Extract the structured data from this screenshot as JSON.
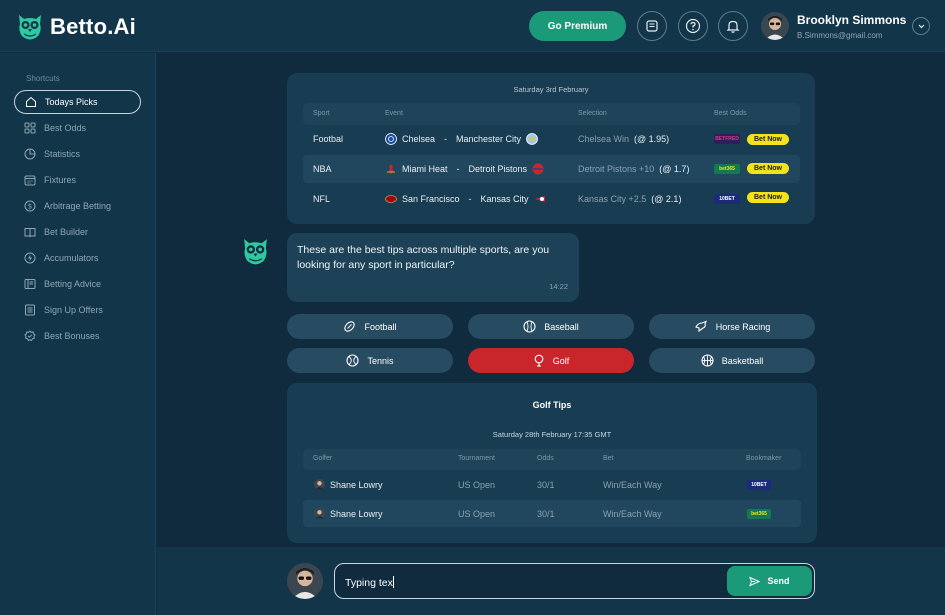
{
  "app": {
    "name": "Betto.Ai"
  },
  "header": {
    "premium_label": "Go Premium",
    "user": {
      "name": "Brooklyn Simmons",
      "email": "B.Simmons@gmail.com"
    }
  },
  "sidebar": {
    "title": "Shortcuts",
    "items": [
      {
        "label": "Todays Picks",
        "icon": "home-icon",
        "active": true
      },
      {
        "label": "Best Odds",
        "icon": "grid-icon"
      },
      {
        "label": "Statistics",
        "icon": "pie-chart-icon"
      },
      {
        "label": "Fixtures",
        "icon": "calendar-icon"
      },
      {
        "label": "Arbitrage Betting",
        "icon": "dollar-icon"
      },
      {
        "label": "Bet Builder",
        "icon": "book-icon"
      },
      {
        "label": "Accumulators",
        "icon": "lightning-icon"
      },
      {
        "label": "Betting Advice",
        "icon": "book-open-icon"
      },
      {
        "label": "Sign Up Offers",
        "icon": "list-icon"
      },
      {
        "label": "Best Bonuses",
        "icon": "badge-icon"
      }
    ]
  },
  "picks": {
    "date": "Saturday 3rd February",
    "headers": [
      "Sport",
      "Event",
      "Selection",
      "Best Odds"
    ],
    "rows": [
      {
        "sport": "Footbal",
        "home": "Chelsea",
        "sep": "-",
        "away": "Manchester City",
        "selection": "Chelsea Win",
        "odds": "(@ 1.95)",
        "bookmaker": "BETFRED",
        "bet_label": "Bet Now"
      },
      {
        "sport": "NBA",
        "home": "Miami Heat",
        "sep": "-",
        "away": "Detroit Pistons",
        "selection": "Detroit Pistons +10",
        "odds": "(@ 1.7)",
        "bookmaker": "bet365",
        "bet_label": "Bet Now"
      },
      {
        "sport": "NFL",
        "home": "San Francisco",
        "sep": "-",
        "away": "Kansas City",
        "selection": "Kansas City +2.5",
        "odds": "(@ 2.1)",
        "bookmaker": "10BET",
        "bet_label": "Bet Now"
      }
    ]
  },
  "message": {
    "text": "These are the best tips across multiple sports, are you looking for any sport in particular?",
    "time": "14:22"
  },
  "sports": [
    {
      "label": "Football",
      "icon": "football-icon"
    },
    {
      "label": "Baseball",
      "icon": "baseball-icon"
    },
    {
      "label": "Horse Racing",
      "icon": "horse-racing-icon"
    },
    {
      "label": "Tennis",
      "icon": "tennis-icon"
    },
    {
      "label": "Golf",
      "icon": "golf-icon",
      "selected": true
    },
    {
      "label": "Basketball",
      "icon": "basketball-icon"
    }
  ],
  "golf": {
    "title": "Golf Tips",
    "date": "Saturday 28th February 17:35 GMT",
    "headers": [
      "Golfer",
      "Tournament",
      "Odds",
      "Bet",
      "Bookmaker"
    ],
    "rows": [
      {
        "golfer": "Shane Lowry",
        "tournament": "US Open",
        "odds": "30/1",
        "bet": "Win/Each Way",
        "bookmaker": "10BET"
      },
      {
        "golfer": "Shane Lowry",
        "tournament": "US Open",
        "odds": "30/1",
        "bet": "Win/Each Way",
        "bookmaker": "bet365"
      }
    ]
  },
  "composer": {
    "value": "Typing tex",
    "send_label": "Send"
  },
  "colors": {
    "accent": "#1a9a79",
    "golf_selected": "#c8262a",
    "bet_now": "#f5e31a",
    "background": "#0f2b3d"
  }
}
